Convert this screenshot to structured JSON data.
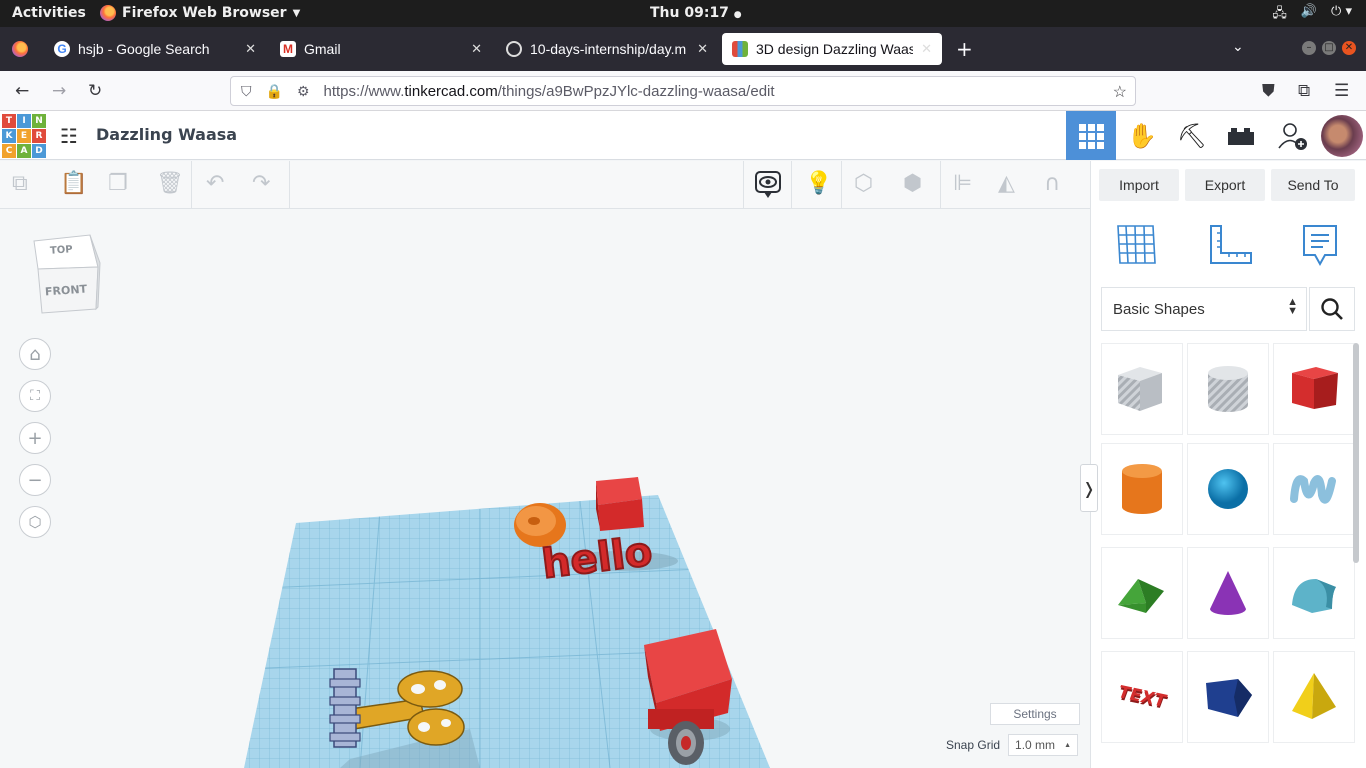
{
  "system_bar": {
    "activities": "Activities",
    "app_name": "Firefox Web Browser",
    "clock": "Thu 09:17"
  },
  "browser": {
    "tabs": [
      {
        "title": "hsjb - Google Search",
        "active": false
      },
      {
        "title": "Gmail",
        "active": false
      },
      {
        "title": "10-days-internship/day.m",
        "active": false
      },
      {
        "title": "3D design Dazzling Waas",
        "active": true
      }
    ],
    "url_prefix": "https://www.",
    "url_domain": "tinkercad.com",
    "url_path": "/things/a9BwPpzJYlc-dazzling-waasa/edit"
  },
  "tinkercad": {
    "logo_letters": [
      "T",
      "I",
      "N",
      "K",
      "E",
      "R",
      "C",
      "A",
      "D"
    ],
    "logo_colors": [
      "#e04b3c",
      "#4c99d7",
      "#6fb23b",
      "#4c99d7",
      "#f1a22c",
      "#e04b3c",
      "#f1a22c",
      "#6fb23b",
      "#4c99d7"
    ],
    "design_title": "Dazzling Waasa",
    "actions": {
      "import": "Import",
      "export": "Export",
      "send_to": "Send To"
    },
    "view_cube": {
      "top": "TOP",
      "front": "FRONT"
    },
    "shape_library": {
      "selected": "Basic Shapes"
    },
    "settings_label": "Settings",
    "snap_grid": {
      "label": "Snap Grid",
      "value": "1.0 mm"
    },
    "scene_text": "hello",
    "shape_text_sample": "TEXT"
  },
  "colors": {
    "accent": "#4d90d8",
    "workplane": "#a8d6ec",
    "shape_red": "#d32a2a",
    "shape_orange": "#e6761c",
    "shape_gold": "#e0a626"
  }
}
